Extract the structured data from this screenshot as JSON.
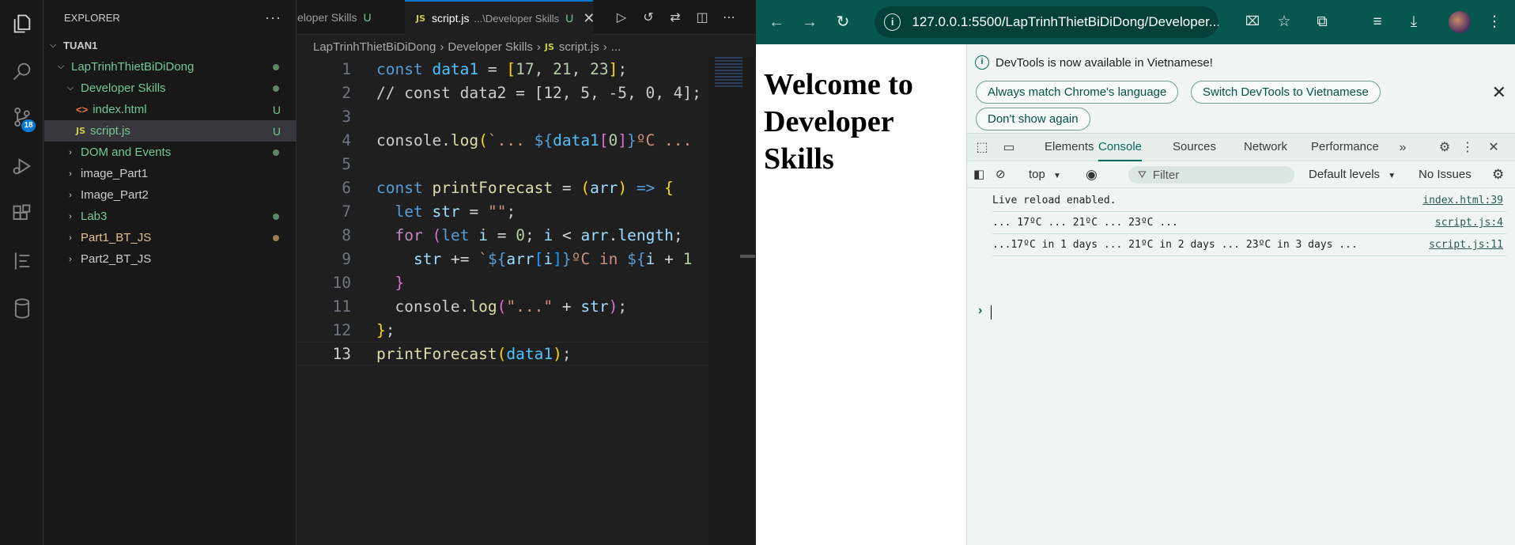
{
  "vscode": {
    "explorer": {
      "title": "EXPLORER",
      "more": "···",
      "root": "TUAN1",
      "items": [
        {
          "label": "LapTrinhThietBiDiDong",
          "mark": ""
        },
        {
          "label": "Developer Skills",
          "mark": ""
        },
        {
          "label": "index.html",
          "mark": "U",
          "icon": "<>"
        },
        {
          "label": "script.js",
          "mark": "U",
          "icon": "JS"
        },
        {
          "label": "DOM and Events",
          "mark": ""
        },
        {
          "label": "image_Part1",
          "mark": ""
        },
        {
          "label": "Image_Part2",
          "mark": ""
        },
        {
          "label": "Lab3",
          "mark": ""
        },
        {
          "label": "Part1_BT_JS",
          "mark": ""
        },
        {
          "label": "Part2_BT_JS",
          "mark": ""
        }
      ]
    },
    "activity_badge": "18",
    "tabs": {
      "inactive_label": "eloper Skills",
      "inactive_mark": "U",
      "active_icon": "JS",
      "active_label": "script.js",
      "active_desc": "...\\Developer Skills",
      "active_mark": "U",
      "close": "✕"
    },
    "breadcrumb": {
      "part1": "LapTrinhThietBiDiDong",
      "part2": "Developer Skills",
      "icon": "JS",
      "part3": "script.js",
      "part4": "..."
    },
    "line_numbers": [
      "1",
      "2",
      "3",
      "4",
      "5",
      "6",
      "7",
      "8",
      "9",
      "10",
      "11",
      "12",
      "13"
    ]
  },
  "chrome": {
    "url": "127.0.0.1:5500/LapTrinhThietBiDiDong/Developer...",
    "page_heading": "Welcome to Developer Skills",
    "infobar": {
      "message": "DevTools is now available in Vietnamese!",
      "btn_match": "Always match Chrome's language",
      "btn_switch": "Switch DevTools to Vietnamese",
      "btn_dont": "Don't show again"
    },
    "devtools_tabs": [
      "Elements",
      "Console",
      "Sources",
      "Network",
      "Performance"
    ],
    "console_bar": {
      "context": "top",
      "filter_placeholder": "Filter",
      "levels": "Default levels",
      "issues": "No Issues"
    },
    "logs": [
      {
        "text": "Live reload enabled.",
        "source": "index.html:39"
      },
      {
        "text": "... 17ºC ... 21ºC ... 23ºC ...",
        "source": "script.js:4"
      },
      {
        "text": "...17ºC in 1 days ... 21ºC in 2 days ... 23ºC in 3 days ...",
        "source": "script.js:11"
      }
    ],
    "prompt": "›"
  }
}
